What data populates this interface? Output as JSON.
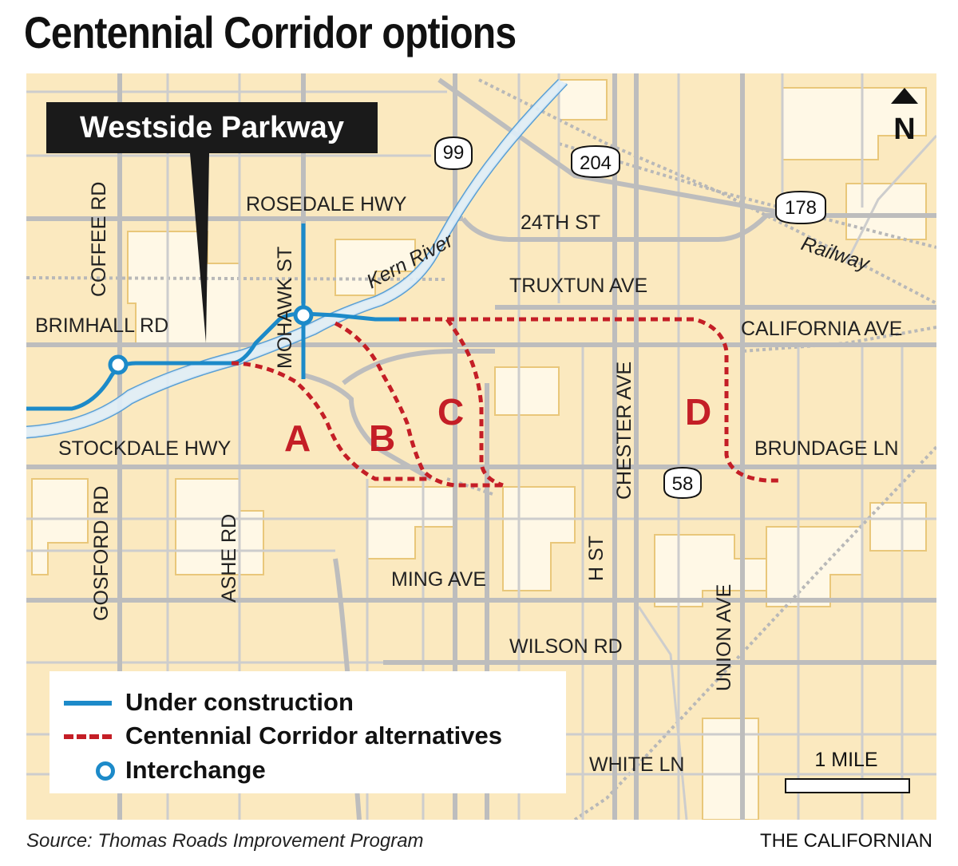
{
  "title": "Centennial Corridor options",
  "callout": "Westside Parkway",
  "north": "N",
  "shields": [
    "99",
    "204",
    "178",
    "58"
  ],
  "roads": {
    "rosedale": "ROSEDALE HWY",
    "twentyfourth": "24TH ST",
    "truxtun": "TRUXTUN AVE",
    "california": "CALIFORNIA AVE",
    "brimhall": "BRIMHALL RD",
    "stockdale": "STOCKDALE HWY",
    "brundage": "BRUNDAGE LN",
    "ming": "MING AVE",
    "wilson": "WILSON RD",
    "white": "WHITE LN",
    "coffee": "COFFEE RD",
    "gosford": "GOSFORD RD",
    "ashe": "ASHE RD",
    "mohawk": "MOHAWK ST",
    "chester": "CHESTER AVE",
    "hst": "H ST",
    "union": "UNION AVE"
  },
  "features": {
    "river": "Kern River",
    "railway": "Railway"
  },
  "alternatives": [
    "A",
    "B",
    "C",
    "D"
  ],
  "legend": {
    "under_construction": "Under construction",
    "alternatives": "Centennial Corridor alternatives",
    "interchange": "Interchange"
  },
  "scale": "1 MILE",
  "source": "Source: Thomas Roads Improvement Program",
  "credit": "THE CALIFORNIAN",
  "colors": {
    "map_bg": "#fbe9bf",
    "parcel": "#fff8e6",
    "road": "#c9c9c9",
    "river": "#5a9fd4",
    "construction": "#1c8ac9",
    "alternatives": "#c41e26"
  }
}
